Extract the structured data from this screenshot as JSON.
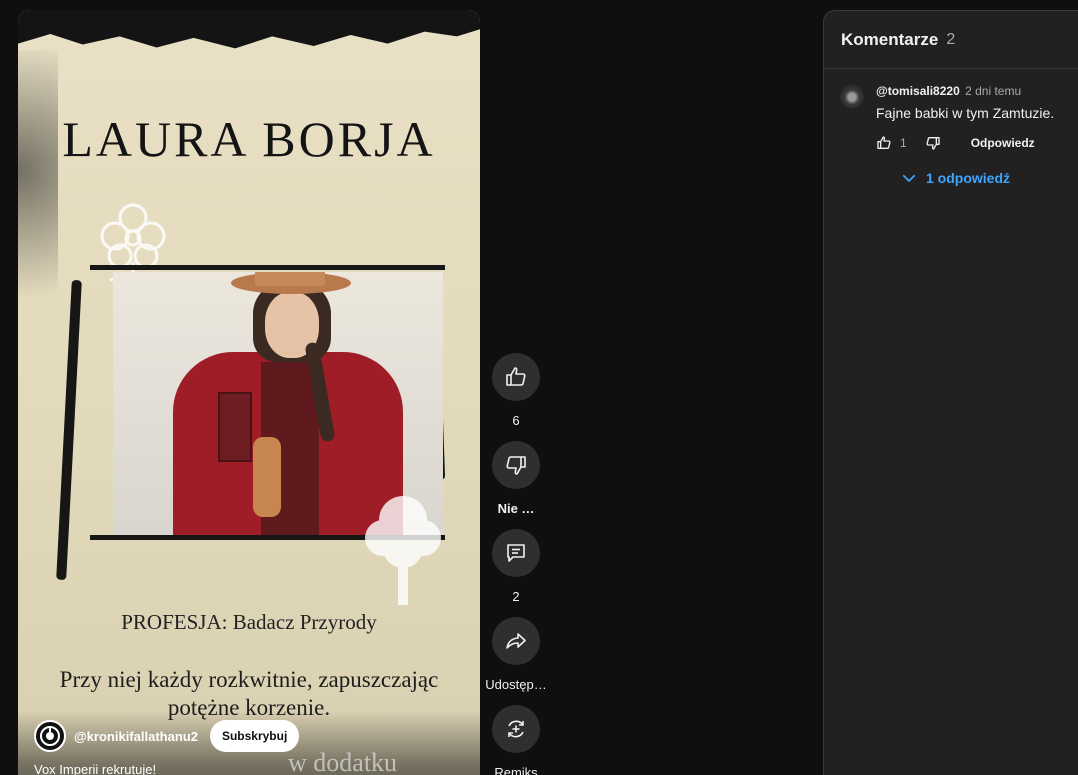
{
  "video": {
    "title_overlay": "LAURA BORJA",
    "profession": "PROFESJA: Badacz Przyrody",
    "tagline": "Przy niej każdy rozkwitnie, zapuszczając potężne korzenie.",
    "faint_text": "w dodatku",
    "channel": "@kronikifallathanu2",
    "subscribe_label": "Subskrybuj",
    "caption": "Vox Imperii rekrutuje!"
  },
  "actions": {
    "like_count": "6",
    "dislike_label": "Nie …",
    "comment_count": "2",
    "share_label": "Udostęp…",
    "remix_label": "Remiks"
  },
  "comments": {
    "title": "Komentarze",
    "count": "2",
    "items": [
      {
        "author": "@tomisali8220",
        "time": "2 dni temu",
        "text": "Fajne babki w tym Zamtuzie.",
        "likes": "1",
        "reply_label": "Odpowiedz",
        "replies_label": "1 odpowiedź"
      }
    ]
  },
  "colors": {
    "background": "#0f0f0f",
    "panel": "#212121",
    "link": "#3ea6ff",
    "paper": "#e6ddc2",
    "jacket": "#9e1d27"
  }
}
